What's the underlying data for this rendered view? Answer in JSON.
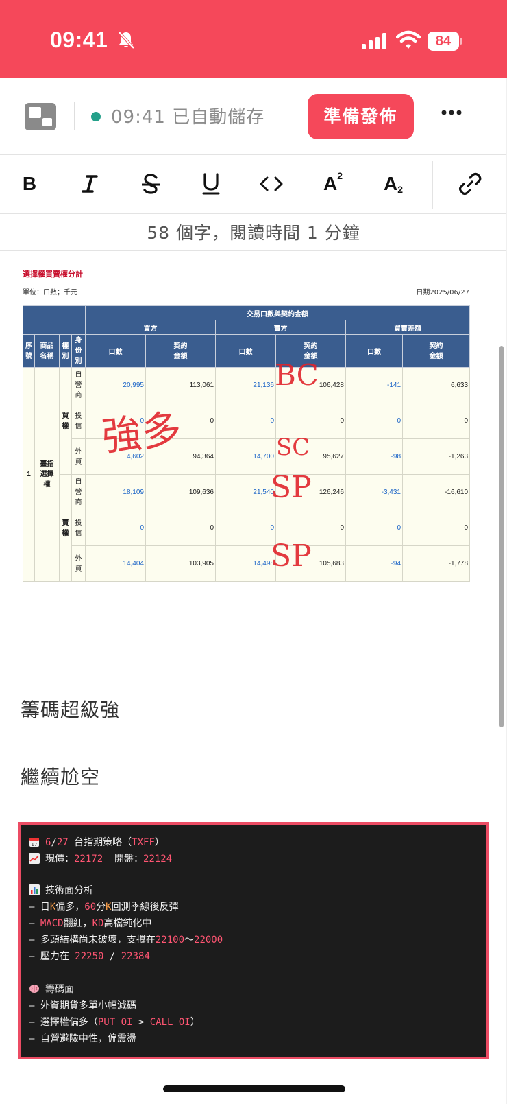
{
  "status_bar": {
    "time": "09:41",
    "battery": "84"
  },
  "header": {
    "save_time": "09:41",
    "save_status": "已自動儲存",
    "publish_label": "準備發佈"
  },
  "toolbar": {
    "bold": "B",
    "superscript_base": "A",
    "superscript_mark": "2",
    "subscript_base": "A",
    "subscript_mark": "2"
  },
  "word_count": "58 個字，閱讀時間 1 分鐘",
  "report": {
    "title": "選擇權買賣權分計",
    "unit": "單位：口數；千元",
    "date": "日期2025/06/27",
    "headers": {
      "group": "交易口數與契約金額",
      "buy": "買方",
      "sell": "賣方",
      "diff": "買賣差額",
      "seq": [
        "序",
        "號"
      ],
      "product": [
        "商品",
        "名稱"
      ],
      "right": [
        "權",
        "別"
      ],
      "identity": [
        "身",
        "份",
        "別"
      ],
      "lots": "口數",
      "amount": [
        "契約",
        "金額"
      ]
    },
    "seq_value": "1",
    "product_value": [
      "臺指",
      "選擇",
      "權"
    ],
    "call_label": [
      "買",
      "權"
    ],
    "put_label": [
      "賣",
      "權"
    ],
    "rows": [
      {
        "identity": [
          "自",
          "營",
          "商"
        ],
        "buy_lots": "20,995",
        "buy_amt": "113,061",
        "sell_lots": "21,136",
        "sell_amt": "106,428",
        "diff_lots": "-141",
        "diff_amt": "6,633"
      },
      {
        "identity": [
          "投",
          "信"
        ],
        "buy_lots": "0",
        "buy_amt": "0",
        "sell_lots": "0",
        "sell_amt": "0",
        "diff_lots": "0",
        "diff_amt": "0"
      },
      {
        "identity": [
          "外",
          "資"
        ],
        "buy_lots": "4,602",
        "buy_amt": "94,364",
        "sell_lots": "14,700",
        "sell_amt": "95,627",
        "diff_lots": "-98",
        "diff_amt": "-1,263"
      },
      {
        "identity": [
          "自",
          "營",
          "商"
        ],
        "buy_lots": "18,109",
        "buy_amt": "109,636",
        "sell_lots": "21,540",
        "sell_amt": "126,246",
        "diff_lots": "-3,431",
        "diff_amt": "-16,610"
      },
      {
        "identity": [
          "投",
          "信"
        ],
        "buy_lots": "0",
        "buy_amt": "0",
        "sell_lots": "0",
        "sell_amt": "0",
        "diff_lots": "0",
        "diff_amt": "0"
      },
      {
        "identity": [
          "外",
          "資"
        ],
        "buy_lots": "14,404",
        "buy_amt": "103,905",
        "sell_lots": "14,498",
        "sell_amt": "105,683",
        "diff_lots": "-94",
        "diff_amt": "-1,778"
      }
    ],
    "annotations": {
      "strong_long": "強多",
      "bc": "BC",
      "sc": "SC",
      "sp1": "SP",
      "sp2": "SP"
    }
  },
  "paragraphs": {
    "p1": "籌碼超級強",
    "p2": "繼續尬空"
  },
  "code": {
    "l1": {
      "date_a": "6",
      "slash": "/",
      "date_b": "27",
      "text": " 台指期策略（",
      "ticker": "TXFF",
      "close": "）"
    },
    "l2": {
      "label_now": "現價：",
      "now": "22172",
      "label_open": "  開盤：",
      "open": "22124"
    },
    "l3": {
      "title": "技術面分析"
    },
    "l4": {
      "dash": "— ",
      "t1": "日",
      "k1": "K",
      "t2": "偏多，",
      "n60": "60",
      "t3": "分",
      "k2": "K",
      "t4": "回測季線後反彈"
    },
    "l5": {
      "dash": "— ",
      "macd": "MACD",
      "t1": "翻紅，",
      "kd": "KD",
      "t2": "高檔鈍化中"
    },
    "l6": {
      "dash": "— ",
      "t1": "多頭結構尚未破壞，支撐在",
      "s1": "22100",
      "tilde": "～",
      "s2": "22000"
    },
    "l7": {
      "dash": "— ",
      "t1": "壓力在 ",
      "r1": "22250",
      "sep": " / ",
      "r2": "22384"
    },
    "l8": {
      "title": "籌碼面"
    },
    "l9": {
      "dash": "— ",
      "t1": "外資期貨多單小幅減碼"
    },
    "l10": {
      "dash": "— ",
      "t1": "選擇權偏多（",
      "put": "PUT OI",
      "gt": " > ",
      "call": "CALL OI",
      "close": "）"
    },
    "l11": {
      "dash": "— ",
      "t1": "自營避險中性，偏震盪"
    }
  }
}
